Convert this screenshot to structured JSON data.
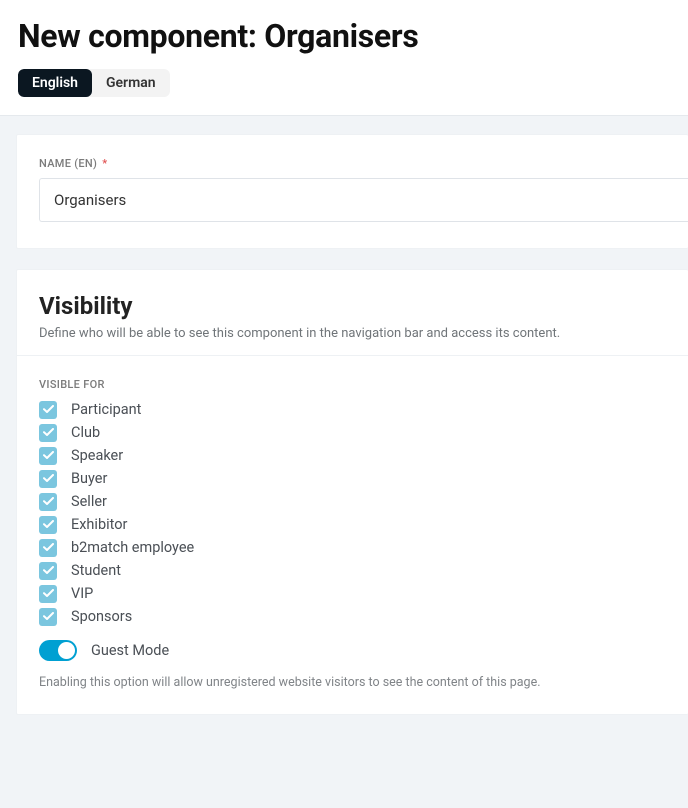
{
  "header": {
    "title": "New component: Organisers",
    "tabs": [
      {
        "label": "English",
        "active": true
      },
      {
        "label": "German",
        "active": false
      }
    ]
  },
  "name_section": {
    "label": "NAME (EN)",
    "required_marker": "*",
    "value": "Organisers"
  },
  "visibility": {
    "title": "Visibility",
    "subtitle": "Define who will be able to see this component in the navigation bar and access its content.",
    "visible_for_label": "VISIBLE FOR",
    "items": [
      {
        "label": "Participant",
        "checked": true
      },
      {
        "label": "Club",
        "checked": true
      },
      {
        "label": "Speaker",
        "checked": true
      },
      {
        "label": "Buyer",
        "checked": true
      },
      {
        "label": "Seller",
        "checked": true
      },
      {
        "label": "Exhibitor",
        "checked": true
      },
      {
        "label": "b2match employee",
        "checked": true
      },
      {
        "label": "Student",
        "checked": true
      },
      {
        "label": "VIP",
        "checked": true
      },
      {
        "label": "Sponsors",
        "checked": true
      }
    ],
    "guest_mode": {
      "label": "Guest Mode",
      "enabled": true,
      "help": "Enabling this option will allow unregistered website visitors to see the content of this page."
    }
  }
}
